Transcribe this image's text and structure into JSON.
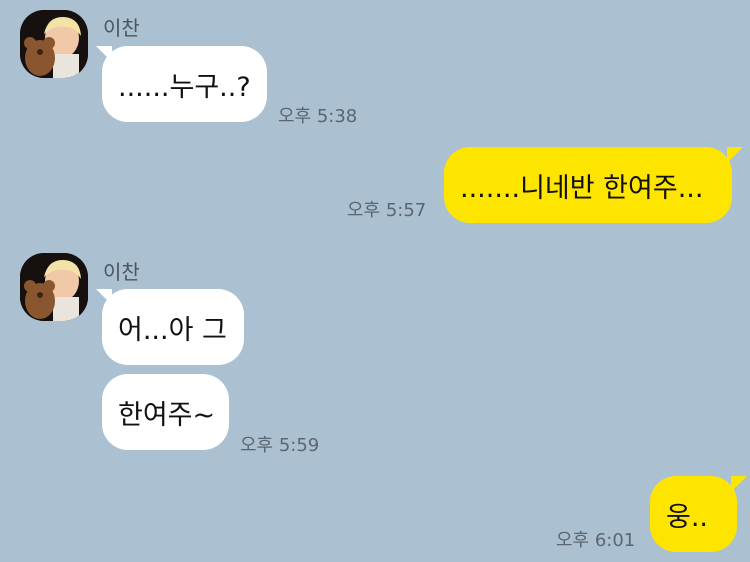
{
  "chat": {
    "messages": [
      {
        "sender": "이찬",
        "text": "......누구..?",
        "time": "오후 5:38"
      },
      {
        "text": ".......니네반 한여주...",
        "time": "오후 5:57"
      },
      {
        "sender": "이찬",
        "text": "어...아 그"
      },
      {
        "text": "한여주~",
        "time": "오후 5:59"
      },
      {
        "text": "웅..",
        "time": "오후 6:01"
      }
    ]
  },
  "colors": {
    "background": "#abc1d1",
    "incoming_bubble": "#ffffff",
    "outgoing_bubble": "#fee500"
  }
}
